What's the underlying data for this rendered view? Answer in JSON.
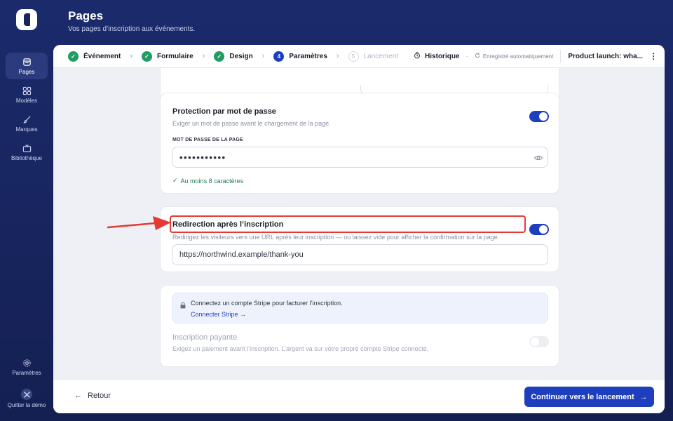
{
  "header": {
    "title": "Pages",
    "subtitle": "Vos pages d’inscription aux événements."
  },
  "sidebar": {
    "items": [
      {
        "label": "Pages",
        "icon": "pages-icon",
        "active": true
      },
      {
        "label": "Modèles",
        "icon": "grid-icon"
      },
      {
        "label": "Marques",
        "icon": "brush-icon"
      },
      {
        "label": "Bibliothèque",
        "icon": "tv-icon"
      }
    ],
    "bottom": [
      {
        "label": "Paramètres",
        "icon": "gear-icon"
      },
      {
        "label": "Quitter la démo",
        "icon": "exit-icon"
      }
    ]
  },
  "steps": [
    {
      "label": "Événement",
      "state": "done"
    },
    {
      "label": "Formulaire",
      "state": "done"
    },
    {
      "label": "Design",
      "state": "done"
    },
    {
      "label": "Paramètres",
      "state": "current",
      "number": "4"
    },
    {
      "label": "Lancement",
      "state": "todo",
      "number": "5"
    }
  ],
  "toolbar": {
    "history": "Historique",
    "autosave": "Enregistré automatiquement",
    "product": "Product launch: wha..."
  },
  "password": {
    "title": "Protection par mot de passe",
    "description": "Exiger un mot de passe avant le chargement de la page.",
    "enabled": true,
    "field_label": "MOT DE PASSE DE LA PAGE",
    "value": "•••••••••••",
    "hint": "Au moins 8 caractères"
  },
  "redirect": {
    "title": "Redirection après l’inscription",
    "description": "Redirigez les visiteurs vers une URL après leur inscription — ou laissez vide pour afficher la confirmation sur la page.",
    "enabled": true,
    "url": "https://northwind.example/thank-you"
  },
  "payment": {
    "stripe_notice": "Connectez un compte Stripe pour facturer l’inscription.",
    "stripe_link": "Connecter Stripe →",
    "title": "Inscription payante",
    "description": "Exigez un paiement avant l’inscription. L’argent va sur votre propre compte Stripe connecté.",
    "enabled": false
  },
  "footer": {
    "back": "Retour",
    "continue": "Continuer vers le lancement"
  },
  "colors": {
    "accent": "#1e3fbd",
    "success": "#1f9d63",
    "annotation": "#e53935",
    "background": "#17245d"
  }
}
